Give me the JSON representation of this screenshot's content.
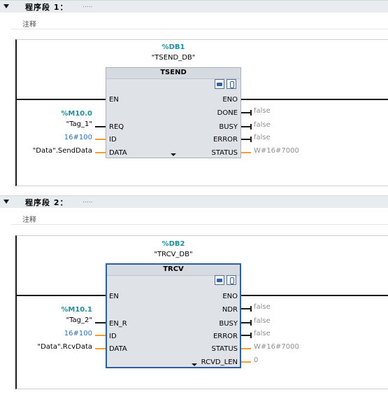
{
  "networks": [
    {
      "title": "程序段 1：",
      "dots": ".....",
      "comment": "注释",
      "db_addr": "%DB1",
      "db_name": "\"TSEND_DB\"",
      "block_name": "TSEND",
      "en": "EN",
      "eno": "ENO",
      "inputs": [
        {
          "pin": "REQ",
          "operand": "\"Tag_1\"",
          "address": "%M10.0"
        },
        {
          "pin": "ID",
          "operand": "16#100"
        },
        {
          "pin": "DATA",
          "operand": "\"Data\".SendData"
        }
      ],
      "outputs": [
        {
          "pin": "DONE",
          "value": "false"
        },
        {
          "pin": "BUSY",
          "value": "false"
        },
        {
          "pin": "ERROR",
          "value": "false"
        },
        {
          "pin": "STATUS",
          "value": "W#16#7000"
        }
      ]
    },
    {
      "title": "程序段 2：",
      "dots": ".....",
      "comment": "注释",
      "db_addr": "%DB2",
      "db_name": "\"TRCV_DB\"",
      "block_name": "TRCV",
      "en": "EN",
      "eno": "ENO",
      "inputs": [
        {
          "pin": "EN_R",
          "operand": "\"Tag_2\"",
          "address": "%M10.1"
        },
        {
          "pin": "ID",
          "operand": "16#100"
        },
        {
          "pin": "DATA",
          "operand": "\"Data\".RcvData"
        }
      ],
      "outputs": [
        {
          "pin": "NDR",
          "value": "false"
        },
        {
          "pin": "BUSY",
          "value": "false"
        },
        {
          "pin": "ERROR",
          "value": "false"
        },
        {
          "pin": "STATUS",
          "value": "W#16#7000"
        },
        {
          "pin": "RCVD_LEN",
          "value": "0"
        }
      ]
    }
  ],
  "colors": {
    "address": "#1f8e9b",
    "constant": "#2a6fb5",
    "monitor_value": "#8f8f8f",
    "wire": "#1a1a1a",
    "orange_wire": "#f0a030",
    "block_fill": "#dfe3e8",
    "selected_border": "#2e5e9e"
  }
}
